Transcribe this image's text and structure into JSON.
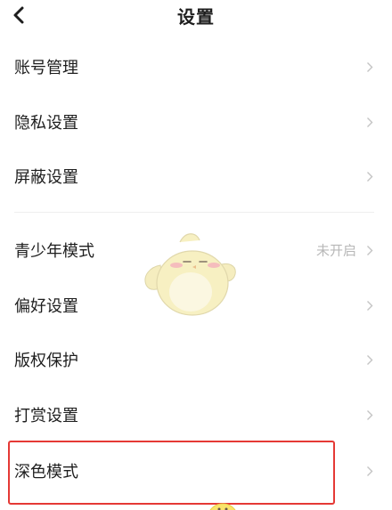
{
  "header": {
    "title": "设置",
    "back_icon": "chevron-left-icon"
  },
  "settings": {
    "items": [
      {
        "label": "账号管理",
        "value": ""
      },
      {
        "label": "隐私设置",
        "value": ""
      },
      {
        "label": "屏蔽设置",
        "value": ""
      },
      {
        "label": "青少年模式",
        "value": "未开启"
      },
      {
        "label": "偏好设置",
        "value": ""
      },
      {
        "label": "版权保护",
        "value": ""
      },
      {
        "label": "打赏设置",
        "value": ""
      },
      {
        "label": "深色模式",
        "value": ""
      }
    ]
  },
  "colors": {
    "text": "#1e1e1e",
    "secondary_text": "#b8b8b8",
    "chevron": "#c4c4c4",
    "highlight": "#e53935",
    "mascot": "#f5e9a6"
  }
}
